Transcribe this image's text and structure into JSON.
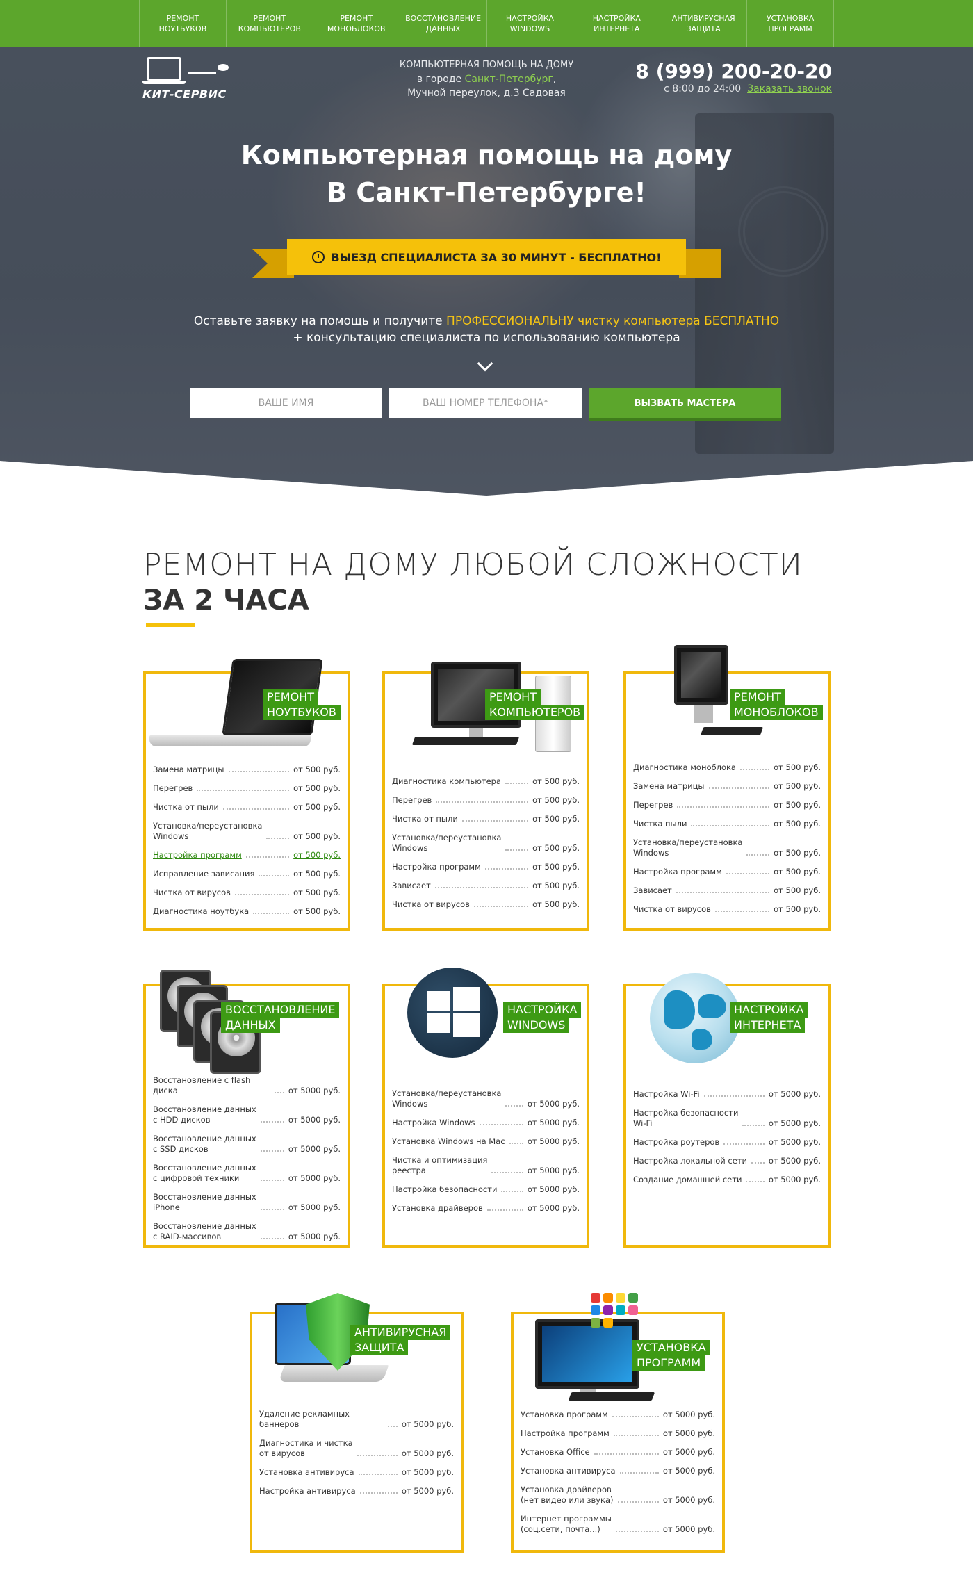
{
  "nav": [
    "Ремонт\nноутбуков",
    "Ремонт\nкомпьютеров",
    "Ремонт\nмоноблоков",
    "Восстановление\nданных",
    "Настройка\nWindows",
    "Настройка\nинтернета",
    "Антивирусная\nзащита",
    "Установка\nпрограмм"
  ],
  "header": {
    "logo": "КИТ-СЕРВИС",
    "addr_line1": "Компьютерная помощь на дому",
    "addr_city_prefix": "в городе ",
    "addr_city": "Санкт-Петербург",
    "addr_city_suffix": ",",
    "addr_line3": "Мучной переулок, д.3  Садовая",
    "phone": "8 (999) 200-20-20",
    "hours": "с 8:00 до 24:00",
    "callback": "Заказать звонок"
  },
  "hero": {
    "title1": "Компьютерная помощь на дому",
    "title2": "В Санкт-Петербурге!",
    "ribbon": "ВЫЕЗД СПЕЦИАЛИСТА ЗА 30 МИНУТ - БЕСПЛАТНО!",
    "offer_a": "Оставьте заявку на помощь и получите ",
    "offer_b": "ПРОФЕССИОНАЛЬНУ чистку компьютера БЕСПЛАТНО",
    "offer_c": "+ консультацию специалиста по использованию компьютера",
    "name_placeholder": "ВАШЕ ИМЯ",
    "phone_placeholder": "ВАШ НОМЕР ТЕЛЕФОНА*",
    "button": "ВЫЗВАТЬ МАСТЕРА"
  },
  "section": {
    "title1": "РЕМОНТ НА ДОМУ ЛЮБОЙ СЛОЖНОСТИ",
    "title2": "ЗА 2 ЧАСА"
  },
  "colors": {
    "green": "#5ca62c",
    "yellow": "#f5c10a",
    "tag_green": "#3d9a14",
    "card_border": "#f0b80c"
  },
  "cards": [
    {
      "tag": [
        "РЕМОНТ",
        "НОУТБУКОВ"
      ],
      "icon": "laptop-icon",
      "items": [
        {
          "n": "Замена матрицы",
          "p": "от 500 руб."
        },
        {
          "n": "Перегрев",
          "p": "от 500 руб."
        },
        {
          "n": "Чистка от пыли",
          "p": "от 500 руб."
        },
        {
          "n": "Установка/переустановка\nWindows",
          "p": "от 500 руб."
        },
        {
          "n": "Настройка программ",
          "p": "от 500 руб.",
          "active": true
        },
        {
          "n": "Исправление зависания",
          "p": "от 500 руб."
        },
        {
          "n": "Чистка от вирусов",
          "p": "от 500 руб."
        },
        {
          "n": "Диагностика ноутбука",
          "p": "от 500 руб."
        }
      ]
    },
    {
      "tag": [
        "РЕМОНТ",
        "КОМПЬЮТЕРОВ"
      ],
      "icon": "desktop-computer-icon",
      "items": [
        {
          "n": "Диагностика компьютера",
          "p": "от 500 руб."
        },
        {
          "n": "Перегрев",
          "p": "от 500 руб."
        },
        {
          "n": "Чистка от пыли",
          "p": "от 500 руб."
        },
        {
          "n": "Установка/переустановка\nWindows",
          "p": "от 500 руб."
        },
        {
          "n": "Настройка программ",
          "p": "от 500 руб."
        },
        {
          "n": "Зависает",
          "p": "от 500 руб."
        },
        {
          "n": "Чистка от вирусов",
          "p": "от 500 руб."
        }
      ]
    },
    {
      "tag": [
        "РЕМОНТ",
        "МОНОБЛОКОВ"
      ],
      "icon": "monoblock-icon",
      "items": [
        {
          "n": "Диагностика моноблока",
          "p": "от 500 руб."
        },
        {
          "n": "Замена матрицы",
          "p": "от 500 руб."
        },
        {
          "n": "Перегрев",
          "p": "от 500 руб."
        },
        {
          "n": "Чистка пыли",
          "p": "от 500 руб."
        },
        {
          "n": "Установка/переустановка\nWindows",
          "p": "от 500 руб."
        },
        {
          "n": "Настройка программ",
          "p": "от 500 руб."
        },
        {
          "n": "Зависает",
          "p": "от 500 руб."
        },
        {
          "n": "Чистка от вирусов",
          "p": "от 500 руб."
        }
      ]
    },
    {
      "tag": [
        "ВОССТАНОВЛЕНИЕ",
        "ДАННЫХ"
      ],
      "icon": "hard-drive-icon",
      "items": [
        {
          "n": "Восстановление с flash диска",
          "p": "от 5000 руб."
        },
        {
          "n": "Восстановление данных\nс HDD дисков",
          "p": "от 5000 руб."
        },
        {
          "n": "Восстановление данных\nс SSD дисков",
          "p": "от 5000 руб."
        },
        {
          "n": "Восстановление данных\nс цифровой техники",
          "p": "от 5000 руб."
        },
        {
          "n": "Восстановление данных\niPhone",
          "p": "от 5000 руб."
        },
        {
          "n": "Восстановление данных\nс RAID-массивов",
          "p": "от 5000 руб."
        }
      ]
    },
    {
      "tag": [
        "НАСТРОЙКА",
        "WINDOWS"
      ],
      "icon": "windows-logo-icon",
      "items": [
        {
          "n": "Установка/переустановка\nWindows",
          "p": "от 5000 руб."
        },
        {
          "n": "Настройка Windows",
          "p": "от 5000 руб."
        },
        {
          "n": "Установка Windows на Mac",
          "p": "от 5000 руб."
        },
        {
          "n": "Чистка и оптимизация\nреестра",
          "p": "от 5000 руб."
        },
        {
          "n": "Настройка безопасности",
          "p": "от 5000 руб."
        },
        {
          "n": "Установка драйверов",
          "p": "от 5000 руб."
        }
      ]
    },
    {
      "tag": [
        "НАСТРОЙКА",
        "ИНТЕРНЕТА"
      ],
      "icon": "globe-icon",
      "items": [
        {
          "n": "Настройка Wi-Fi",
          "p": "от 5000 руб."
        },
        {
          "n": "Настройка безопасности\nWi-Fi",
          "p": "от 5000 руб."
        },
        {
          "n": "Настройка роутеров",
          "p": "от 5000 руб."
        },
        {
          "n": "Настройка локальной сети",
          "p": "от 5000 руб."
        },
        {
          "n": "Создание домашней сети",
          "p": "от 5000 руб."
        }
      ]
    },
    {
      "tag": [
        "АНТИВИРУСНАЯ",
        "ЗАЩИТА"
      ],
      "icon": "antivirus-shield-icon",
      "items": [
        {
          "n": "Удаление рекламных баннеров",
          "p": "от 5000 руб."
        },
        {
          "n": "Диагностика и чистка\nот вирусов",
          "p": "от 5000 руб."
        },
        {
          "n": "Установка антивируса",
          "p": "от 5000 руб."
        },
        {
          "n": "Настройка антивируса",
          "p": "от 5000 руб."
        }
      ]
    },
    {
      "tag": [
        "УСТАНОВКА",
        "ПРОГРАММ"
      ],
      "icon": "software-apps-icon",
      "items": [
        {
          "n": "Установка программ",
          "p": "от 5000 руб."
        },
        {
          "n": "Настройка программ",
          "p": "от 5000 руб."
        },
        {
          "n": "Установка Office",
          "p": "от 5000 руб."
        },
        {
          "n": "Установка антивируса",
          "p": "от 5000 руб."
        },
        {
          "n": "Установка драйверов\n(нет видео или звука)",
          "p": "от 5000 руб."
        },
        {
          "n": "Интернет программы\n(соц.сети, почта...)",
          "p": "от 5000 руб."
        }
      ]
    }
  ]
}
